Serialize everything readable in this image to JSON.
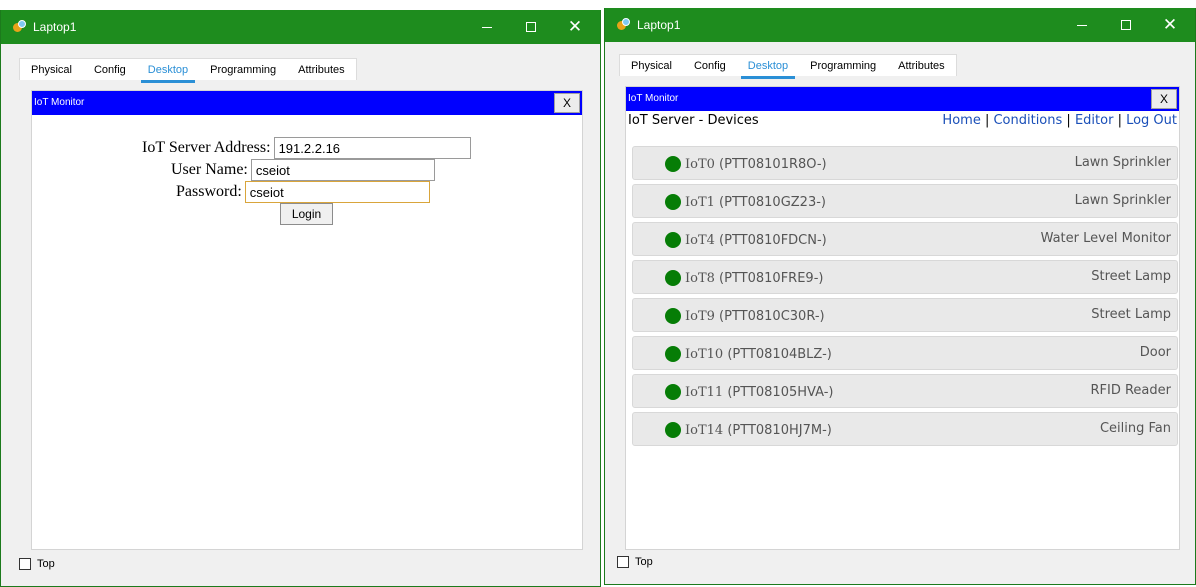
{
  "left_window": {
    "title": "Laptop1",
    "tabs": [
      "Physical",
      "Config",
      "Desktop",
      "Programming",
      "Attributes"
    ],
    "active_tab": "Desktop",
    "monitor_title": "IoT Monitor",
    "close_label": "X",
    "form": {
      "server_label": "IoT Server Address:",
      "server_value": "191.2.2.16",
      "user_label": "User Name:",
      "user_value": "cseiot",
      "password_label": "Password:",
      "password_value": "cseiot",
      "login_label": "Login"
    },
    "top_label": "Top"
  },
  "right_window": {
    "title": "Laptop1",
    "tabs": [
      "Physical",
      "Config",
      "Desktop",
      "Programming",
      "Attributes"
    ],
    "active_tab": "Desktop",
    "monitor_title": "IoT Monitor",
    "close_label": "X",
    "header_title": "IoT Server - Devices",
    "nav": {
      "home": "Home",
      "sep": "|",
      "conditions": "Conditions",
      "editor": "Editor",
      "logout": "Log Out"
    },
    "devices": [
      {
        "name": "IoT0",
        "id": "(PTT08101R8O-)",
        "type": "Lawn Sprinkler",
        "status_color": "#067d06"
      },
      {
        "name": "IoT1",
        "id": "(PTT0810GZ23-)",
        "type": "Lawn Sprinkler",
        "status_color": "#067d06"
      },
      {
        "name": "IoT4",
        "id": "(PTT0810FDCN-)",
        "type": "Water Level Monitor",
        "status_color": "#067d06"
      },
      {
        "name": "IoT8",
        "id": "(PTT0810FRE9-)",
        "type": "Street Lamp",
        "status_color": "#067d06"
      },
      {
        "name": "IoT9",
        "id": "(PTT0810C30R-)",
        "type": "Street Lamp",
        "status_color": "#067d06"
      },
      {
        "name": "IoT10",
        "id": "(PTT08104BLZ-)",
        "type": "Door",
        "status_color": "#067d06"
      },
      {
        "name": "IoT11",
        "id": "(PTT08105HVA-)",
        "type": "RFID Reader",
        "status_color": "#067d06"
      },
      {
        "name": "IoT14",
        "id": "(PTT0810HJ7M-)",
        "type": "Ceiling Fan",
        "status_color": "#067d06"
      }
    ],
    "top_label": "Top"
  },
  "colors": {
    "titlebar": "#1e8c1e",
    "monitor_bar": "#0000ff",
    "active_tab": "#2a8fd6",
    "status_online": "#067d06"
  }
}
